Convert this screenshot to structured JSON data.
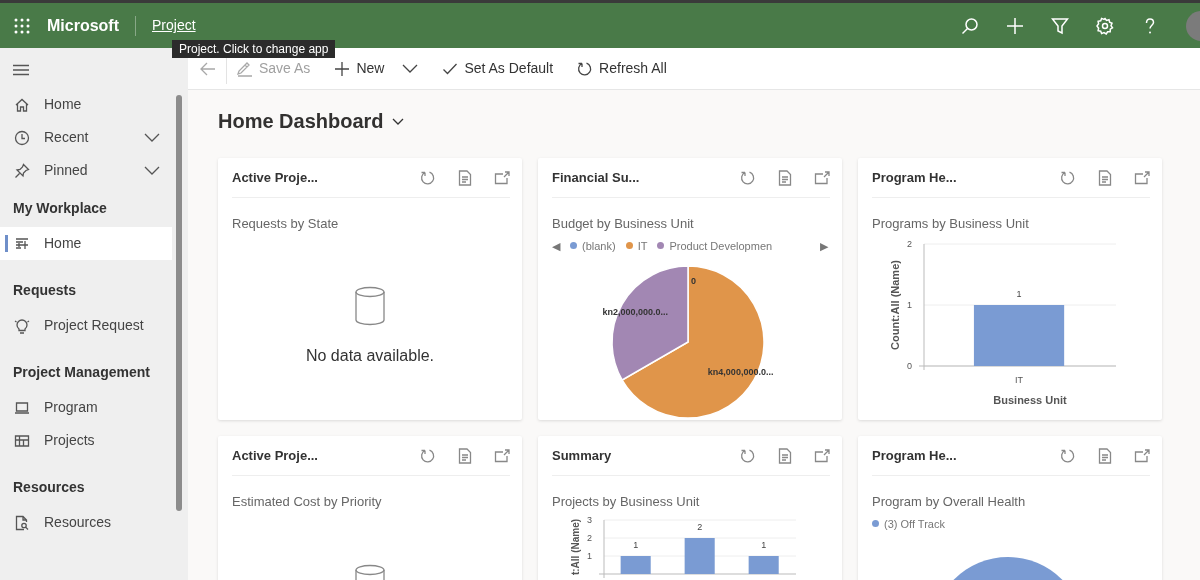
{
  "top_bar": {
    "brand": "Microsoft",
    "app_link": "Project",
    "tooltip": "Project. Click to change app"
  },
  "command_bar": [
    {
      "kind": "back",
      "disabled": true
    },
    {
      "kind": "button",
      "label": "Save As",
      "disabled": true
    },
    {
      "kind": "split",
      "label": "New",
      "disabled": false
    },
    {
      "kind": "button",
      "label": "Set As Default",
      "disabled": false
    },
    {
      "kind": "button",
      "label": "Refresh All",
      "disabled": false
    }
  ],
  "sidebar": {
    "items": [
      {
        "label": "Home",
        "kind": "link",
        "selected": false
      },
      {
        "label": "Recent",
        "kind": "group",
        "selected": false
      },
      {
        "label": "Pinned",
        "kind": "group",
        "selected": false
      }
    ],
    "sections": [
      {
        "title": "My Workplace",
        "items": [
          {
            "label": "Home",
            "selected": true
          }
        ]
      },
      {
        "title": "Requests",
        "items": [
          {
            "label": "Project Request",
            "selected": false
          }
        ]
      },
      {
        "title": "Project Management",
        "items": [
          {
            "label": "Program",
            "selected": false
          },
          {
            "label": "Projects",
            "selected": false
          }
        ]
      },
      {
        "title": "Resources",
        "items": [
          {
            "label": "Resources",
            "selected": false
          }
        ]
      }
    ]
  },
  "dashboard": {
    "title": "Home Dashboard",
    "cards": [
      {
        "title": "Active Proje...",
        "subtitle": "Requests by State",
        "kind": "empty",
        "message": "No data available."
      },
      {
        "title": "Financial Su...",
        "subtitle": "Budget by Business Unit",
        "kind": "pie",
        "legend_prev": "◀",
        "legend_next": "▶",
        "chart_data": {
          "type": "pie",
          "legend": "top",
          "categories": [
            "(blank)",
            "IT",
            "Product Developmen"
          ],
          "values": [
            0,
            4000000,
            2000000
          ],
          "colors": [
            "#7a9bd3",
            "#e0954a",
            "#a287b3"
          ],
          "value_labels": [
            "0",
            "kn4,000,000.0...",
            "kn2,000,000.0..."
          ]
        }
      },
      {
        "title": "Program He...",
        "subtitle": "Programs by Business Unit",
        "kind": "bar",
        "chart_data": {
          "type": "bar",
          "categories": [
            "IT"
          ],
          "values": [
            1
          ],
          "xlabel": "Business Unit",
          "ylabel": "Count:All (Name)",
          "ylim": [
            0,
            2
          ],
          "yticks": [
            0,
            1,
            2
          ],
          "data_labels": true
        }
      },
      {
        "title": "Active Proje...",
        "subtitle": "Estimated Cost by Priority",
        "kind": "empty"
      },
      {
        "title": "Summary",
        "subtitle": "Projects by Business Unit",
        "kind": "bar",
        "chart_data": {
          "type": "bar",
          "values": [
            1,
            2,
            1
          ],
          "ylabel": "t:All (Name)",
          "ylim": [
            0,
            3
          ],
          "yticks": [
            1,
            2,
            3
          ],
          "data_labels": true
        }
      },
      {
        "title": "Program He...",
        "subtitle": "Program by Overall Health",
        "kind": "pie",
        "chart_data": {
          "type": "pie",
          "legend": "top",
          "categories": [
            "(3) Off Track"
          ],
          "values": [
            3
          ],
          "colors": [
            "#7a9bd3"
          ]
        }
      }
    ]
  }
}
